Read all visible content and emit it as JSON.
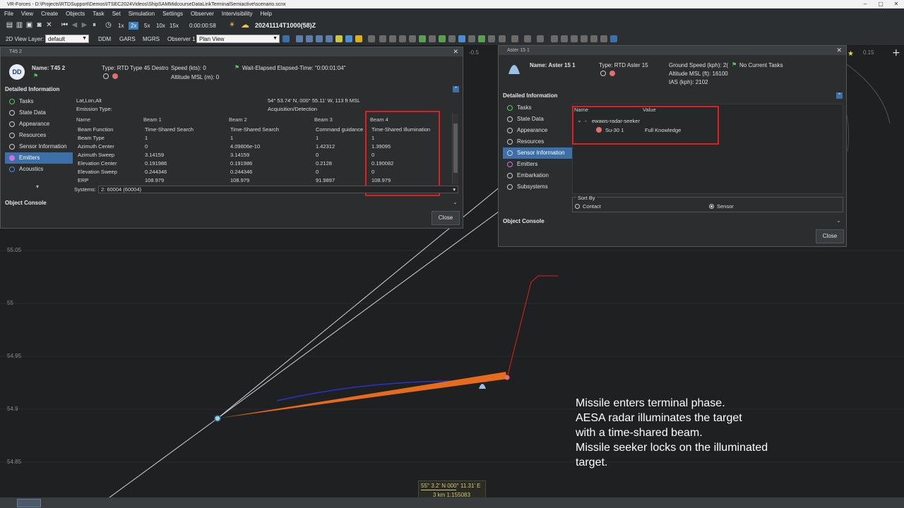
{
  "window": {
    "title": "VR-Forces - D:\\Projects\\RTDSupport\\Demos\\ITSEC2024Videos\\ShipSAMMidcourseDataLinkTerminalSemiactive\\scenario.scnx"
  },
  "menu": [
    "File",
    "View",
    "Create",
    "Objects",
    "Task",
    "Set",
    "Simulation",
    "Settings",
    "Observer",
    "Intervisibility",
    "Help"
  ],
  "toolbar": {
    "speeds": [
      "1x",
      "2x",
      "5x",
      "10x",
      "15x"
    ],
    "active_speed": "2x",
    "sim_clock": "0:00:00:58",
    "datetime": "20241114T1000(58)Z"
  },
  "toolbar2": {
    "view_layer_label": "2D View Layer:",
    "view_layer_value": "default",
    "ddm": "DDM",
    "gars": "GARS",
    "mgrs": "MGRS",
    "observer_label": "Observer 1",
    "observer_view": "Plan View"
  },
  "map": {
    "lat_labels": [
      "55.05",
      "55",
      "54.95",
      "54.9",
      "54.85"
    ],
    "lon_labels": [
      "-0.5",
      "0.15"
    ],
    "caption": [
      "Missile enters terminal phase.",
      "AESA radar illuminates the target",
      "with a time-shared beam.",
      "Missile seeker locks on the illuminated",
      "target."
    ],
    "cursor_coords": "55° 3.2' N  000° 11.31' E",
    "scale": "3 km   1:155083"
  },
  "dialog_t45": {
    "title": "T45 2",
    "icon_text": "DD",
    "name_label": "Name: T45 2",
    "type_label": "Type: RTD Type 45 Destro",
    "speed_label": "Speed (kts): 0",
    "altitude_label": "Altitude MSL (m): 0",
    "task_label": "Wait-Elapsed Elapsed-Time: \"0:00:01:04\"",
    "detailed_info": "Detailed Information",
    "nav": [
      "Tasks",
      "State Data",
      "Appearance",
      "Resources",
      "Sensor Information",
      "Emitters",
      "Acoustics"
    ],
    "selected_nav": "Emitters",
    "lat_lon_alt_label": "Lat,Lon,Alt",
    "lat_lon_alt_value": "54° 53.74' N, 000° 55.11' W, 113 ft MSL",
    "emission_type_label": "Emission Type:",
    "emission_type_value": "Acquisition/Detection",
    "table_headers": [
      "Name",
      "Beam 1",
      "Beam 2",
      "Beam 3",
      "Beam 4"
    ],
    "table_rows": [
      [
        "Beam Function",
        "Time-Shared Search",
        "Time-Shared Search",
        "Command guidance",
        "Time-Shared Illumination"
      ],
      [
        "Beam Type",
        "1",
        "1",
        "1",
        "1"
      ],
      [
        "Azimuth Center",
        "0",
        "4.09806e-10",
        "1.42312",
        "1.39095"
      ],
      [
        "Azimuth Sweep",
        "3.14159",
        "3.14159",
        "0",
        "0"
      ],
      [
        "Elevation Center",
        "0.191986",
        "0.191986",
        "0.2128",
        "0.190082"
      ],
      [
        "Elevation Sweep",
        "0.244346",
        "0.244346",
        "0",
        "0"
      ],
      [
        "ERP",
        "108.979",
        "108.979",
        "91.9897",
        "108.979"
      ]
    ],
    "systems_label": "Systems:",
    "systems_value": "2: 60004 (60004)",
    "object_console": "Object Console",
    "close": "Close"
  },
  "dialog_aster": {
    "title": "Aster 15 1",
    "name_label": "Name: Aster 15 1",
    "type_label": "Type: RTD Aster 15",
    "ground_speed_label": "Ground Speed (kph): 2(",
    "altitude_label": "Altitude MSL (ft): 16100",
    "ias_label": "IAS (kph): 2102",
    "task_label": "No Current Tasks",
    "detailed_info": "Detailed Information",
    "nav": [
      "Tasks",
      "State Data",
      "Appearance",
      "Resources",
      "Sensor Information",
      "Emitters",
      "Embarkation",
      "Subsystems"
    ],
    "selected_nav": "Sensor Information",
    "table_headers": [
      "Name",
      "Value"
    ],
    "sensor_name": "ewaws-radar-seeker",
    "contact_name": "Su-30 1",
    "contact_value": "Full Knowledge",
    "sort_by": "Sort By",
    "sort_contact": "Contact",
    "sort_sensor": "Sensor",
    "object_console": "Object Console",
    "close": "Close"
  }
}
